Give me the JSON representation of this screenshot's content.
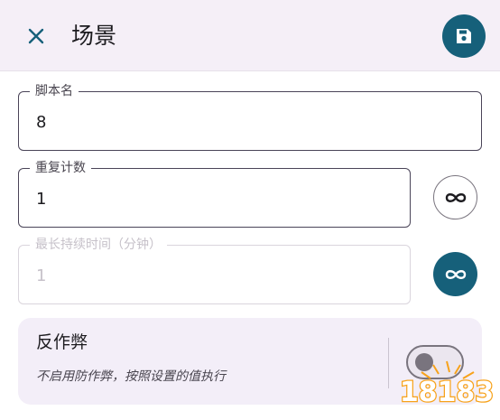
{
  "appbar": {
    "title": "场景",
    "close_icon": "close-icon",
    "save_icon": "save-icon",
    "accent_color": "#16607a"
  },
  "fields": {
    "script_name": {
      "label": "脚本名",
      "value": "8"
    },
    "repeat_count": {
      "label": "重复计数",
      "value": "1",
      "infinite_icon": "infinity-icon",
      "infinite_enabled": false
    },
    "max_duration": {
      "label": "最长持续时间（分钟）",
      "value": "1",
      "disabled": true,
      "infinite_icon": "infinity-icon",
      "infinite_enabled": true
    }
  },
  "anti_cheat": {
    "title": "反作弊",
    "subtitle": "不启用防作弊，按照设置的值执行",
    "enabled": false
  },
  "watermark": {
    "text": "18183"
  }
}
